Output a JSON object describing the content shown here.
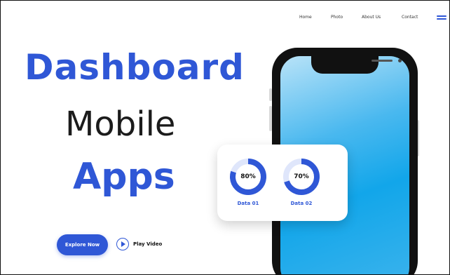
{
  "nav": {
    "items": [
      {
        "label": "Home"
      },
      {
        "label": "Photo"
      },
      {
        "label": "About Us"
      },
      {
        "label": "Contact"
      }
    ]
  },
  "hero": {
    "line1": "Dashboard",
    "line2": "Mobile",
    "line3": "Apps"
  },
  "cta": {
    "explore_label": "Explore Now",
    "play_label": "Play Video"
  },
  "data_card": {
    "items": [
      {
        "label": "Data 01",
        "value_text": "80%",
        "value": 0.8
      },
      {
        "label": "Data 02",
        "value_text": "70%",
        "value": 0.7
      }
    ]
  },
  "colors": {
    "accent": "#2f57d6",
    "screen": "#12a6ea",
    "ring_track": "#dfe6fb"
  },
  "icons": {
    "menu": "hamburger-menu-icon",
    "play": "play-icon"
  }
}
